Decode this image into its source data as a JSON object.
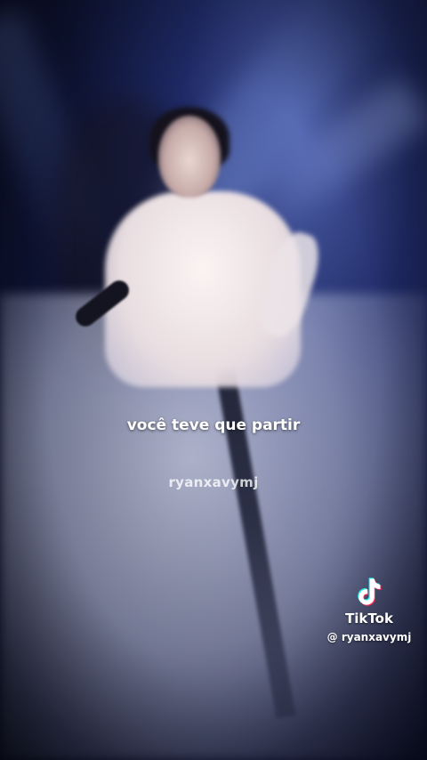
{
  "video": {
    "caption": "você teve que partir",
    "watermark_text": "ryanxavymj"
  },
  "tiktok": {
    "brand": "TikTok",
    "handle": "@ ryanxavymj",
    "logo_icon": "tiktok-logo-icon"
  },
  "colors": {
    "caption_text": "#ffffff",
    "logo_cyan": "#25f4ee",
    "logo_red": "#fe2c55"
  }
}
